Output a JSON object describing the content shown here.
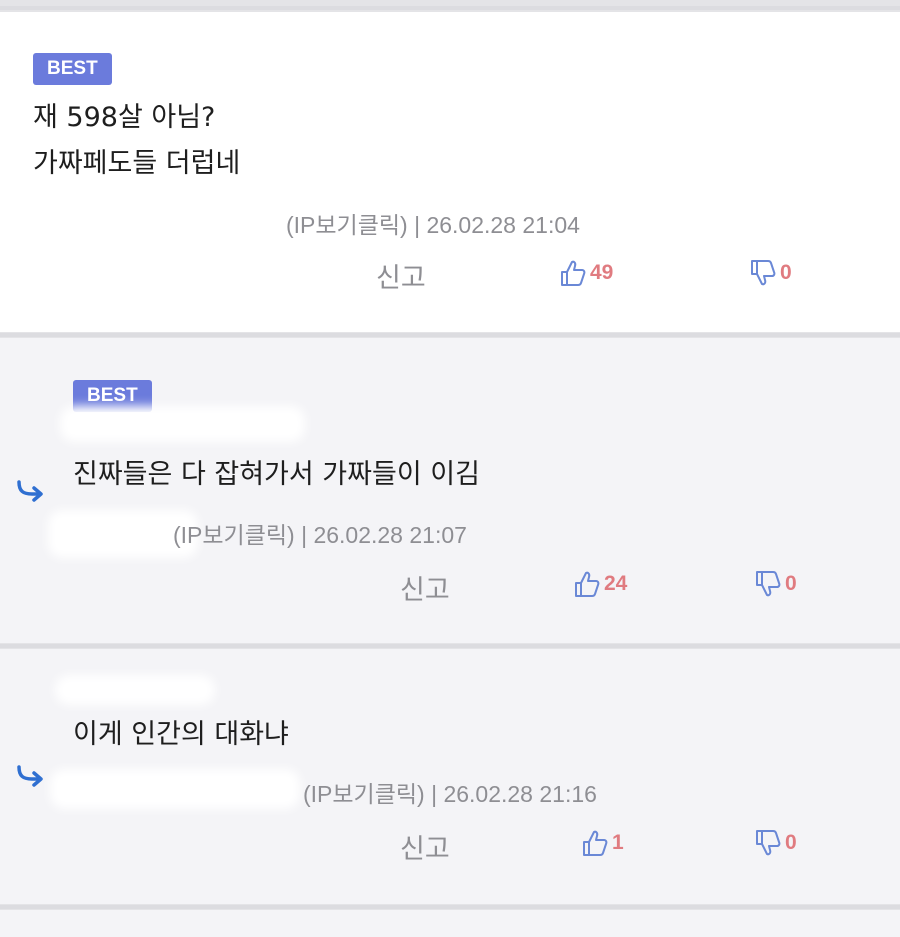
{
  "comments": [
    {
      "badge": "BEST",
      "text_lines": [
        "재 598살 아님?",
        "가짜페도들 더럽네"
      ],
      "meta": "(IP보기클릭) | 26.02.28 21:04",
      "report": "신고",
      "likes": "49",
      "dislikes": "0"
    },
    {
      "badge": "BEST",
      "text_lines": [
        "진짜들은 다 잡혀가서 가짜들이 이김"
      ],
      "meta": "(IP보기클릭) | 26.02.28 21:07",
      "report": "신고",
      "likes": "24",
      "dislikes": "0"
    },
    {
      "text_lines": [
        "이게 인간의 대화냐"
      ],
      "meta": "(IP보기클릭) | 26.02.28 21:16",
      "report": "신고",
      "likes": "1",
      "dislikes": "0"
    }
  ],
  "icons": {
    "like": "thumbs-up-icon",
    "dislike": "thumbs-down-icon",
    "reply": "reply-arrow-icon"
  },
  "colors": {
    "badge": "#6b7bdc",
    "count": "#e07b80",
    "icon": "#6a88d6",
    "reply_arrow": "#2f6fd1"
  }
}
